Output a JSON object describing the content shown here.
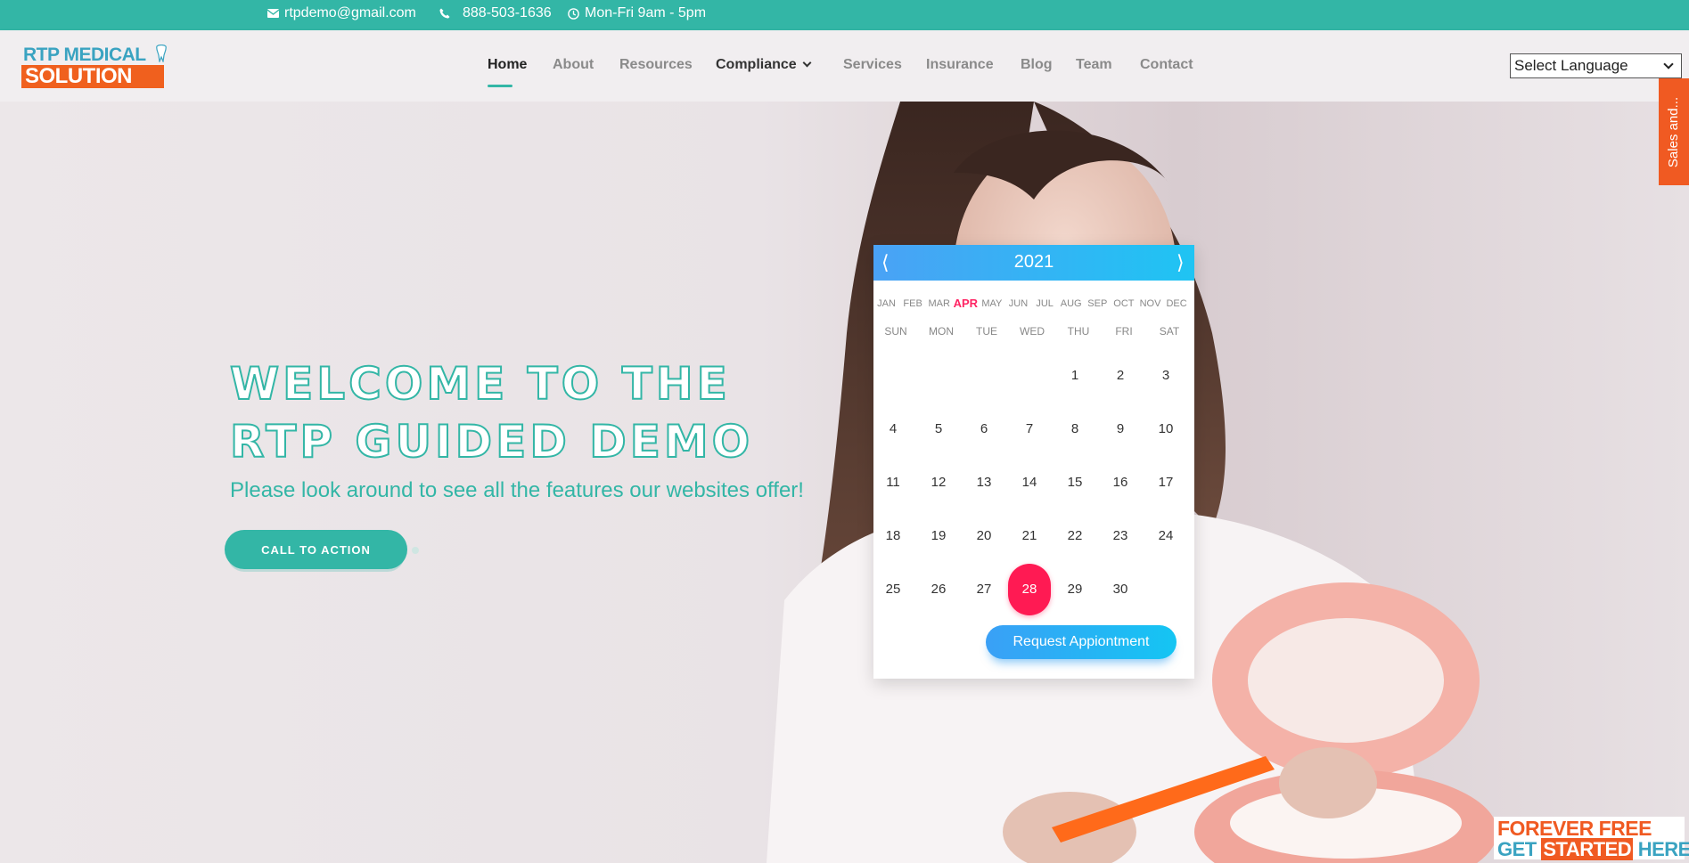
{
  "topbar": {
    "email": "rtpdemo@gmail.com",
    "phone": "888-503-1636",
    "hours": "Mon-Fri 9am - 5pm"
  },
  "logo": {
    "line1": "RTP MEDICAL",
    "line2": "SOLUTION"
  },
  "nav": {
    "items": [
      {
        "label": "Home"
      },
      {
        "label": "About"
      },
      {
        "label": "Resources"
      },
      {
        "label": "Compliance"
      },
      {
        "label": "Services"
      },
      {
        "label": "Insurance"
      },
      {
        "label": "Blog"
      },
      {
        "label": "Team"
      },
      {
        "label": "Contact"
      }
    ],
    "active": "Home"
  },
  "language_select": {
    "value": "Select Language"
  },
  "sales_tab": {
    "label": "Sales and..."
  },
  "hero": {
    "title_line1": "WELCOME TO THE",
    "title_line2": "RTP GUIDED DEMO",
    "subtitle": "Please look around to see all the features our websites offer!",
    "cta_label": "CALL TO ACTION"
  },
  "calendar": {
    "year": "2021",
    "prev": "⟨",
    "next": "⟩",
    "months": [
      "JAN",
      "FEB",
      "MAR",
      "APR",
      "MAY",
      "JUN",
      "JUL",
      "AUG",
      "SEP",
      "OCT",
      "NOV",
      "DEC"
    ],
    "selected_month": "APR",
    "weekdays": [
      "SUN",
      "MON",
      "TUE",
      "WED",
      "THU",
      "FRI",
      "SAT"
    ],
    "days": [
      "1",
      "2",
      "3",
      "4",
      "5",
      "6",
      "7",
      "8",
      "9",
      "10",
      "11",
      "12",
      "13",
      "14",
      "15",
      "16",
      "17",
      "18",
      "19",
      "20",
      "21",
      "22",
      "23",
      "24",
      "25",
      "26",
      "27",
      "28",
      "29",
      "30"
    ],
    "selected_day": "28",
    "button_label": "Request Appiontment"
  },
  "badge": {
    "line1": "FOREVER FREE",
    "line2_a": "GET ",
    "line2_b": "STARTED",
    "line2_c": " HERE"
  },
  "colors": {
    "teal": "#33b6a6",
    "orange": "#f05a22",
    "calendar_blue": "#1fc4f3",
    "highlight_pink": "#ff1a53"
  }
}
